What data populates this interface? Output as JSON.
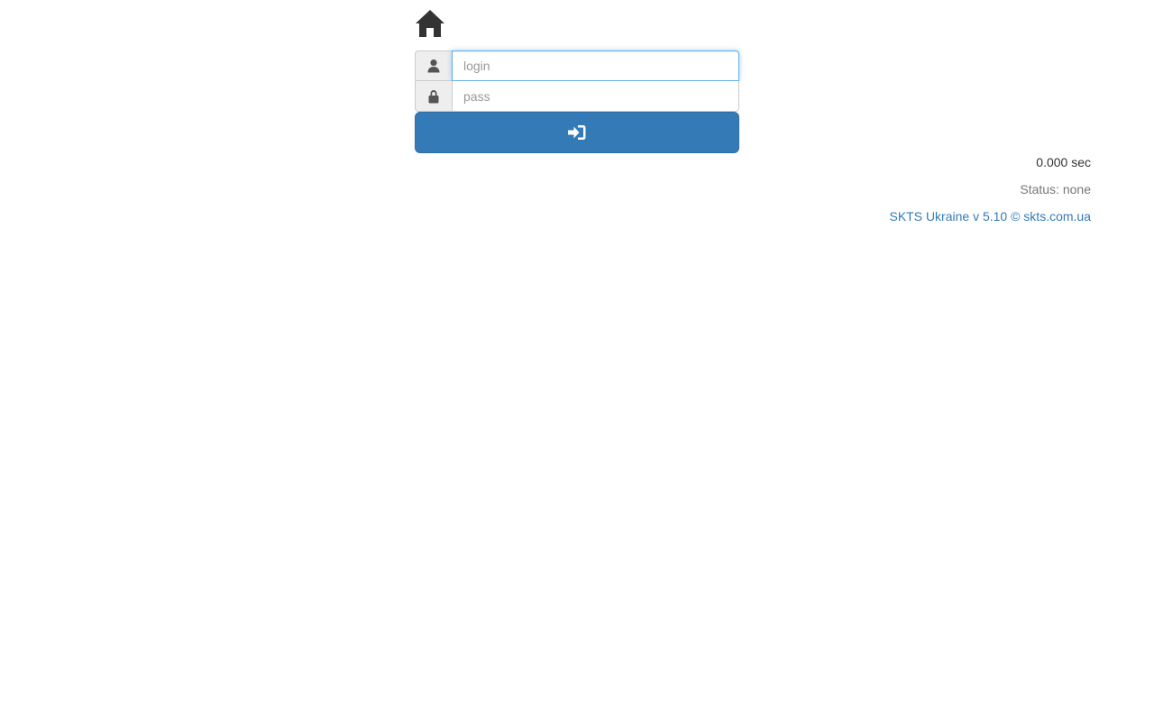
{
  "header": {
    "home_icon": "home-icon"
  },
  "login_form": {
    "login": {
      "icon": "user-icon",
      "value": "",
      "placeholder": "login"
    },
    "password": {
      "icon": "lock-icon",
      "value": "",
      "placeholder": "pass"
    },
    "submit": {
      "icon": "sign-in-icon"
    }
  },
  "info": {
    "timer": "0.000 sec",
    "status_label": "Status:",
    "status_value": "none",
    "footer_link": "SKTS Ukraine v 5.10 © skts.com.ua"
  },
  "colors": {
    "primary": "#337ab7",
    "icon_dark": "#333333",
    "muted_text": "#777777",
    "addon_bg": "#eeeeee",
    "focus_border": "#66afe9"
  }
}
